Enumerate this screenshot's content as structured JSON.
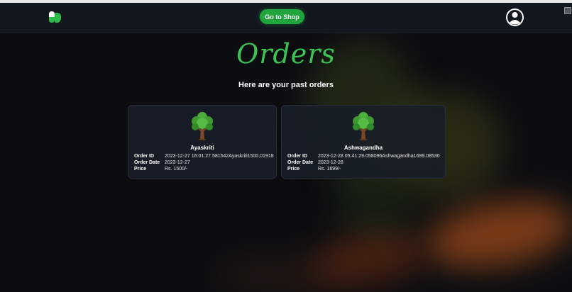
{
  "navbar": {
    "logo_icon": "pill-leaf-logo",
    "shop_button_label": "Go to Shop",
    "profile_icon": "user-avatar-icon"
  },
  "page": {
    "title": "Orders",
    "subtitle": "Here are your past orders"
  },
  "labels": {
    "order_id": "Order ID",
    "order_date": "Order Date",
    "price": "Price"
  },
  "orders": [
    {
      "name": "Ayaskriti",
      "order_id": "2023-12-27 16:01:27.581542Ayaskriti1500.01918",
      "order_date": "2023-12-27",
      "price": "Rs. 1500/-",
      "icon": "tree-icon"
    },
    {
      "name": "Ashwagandha",
      "order_id": "2023-12-28 05:41:29.058096Ashwagandha1699.08530",
      "order_date": "2023-12-28",
      "price": "Rs. 1699/-",
      "icon": "tree-icon"
    }
  ],
  "colors": {
    "accent_green": "#1fa53b",
    "title_green": "#3cc455",
    "background": "#0b0d10",
    "card": "#181e28"
  }
}
